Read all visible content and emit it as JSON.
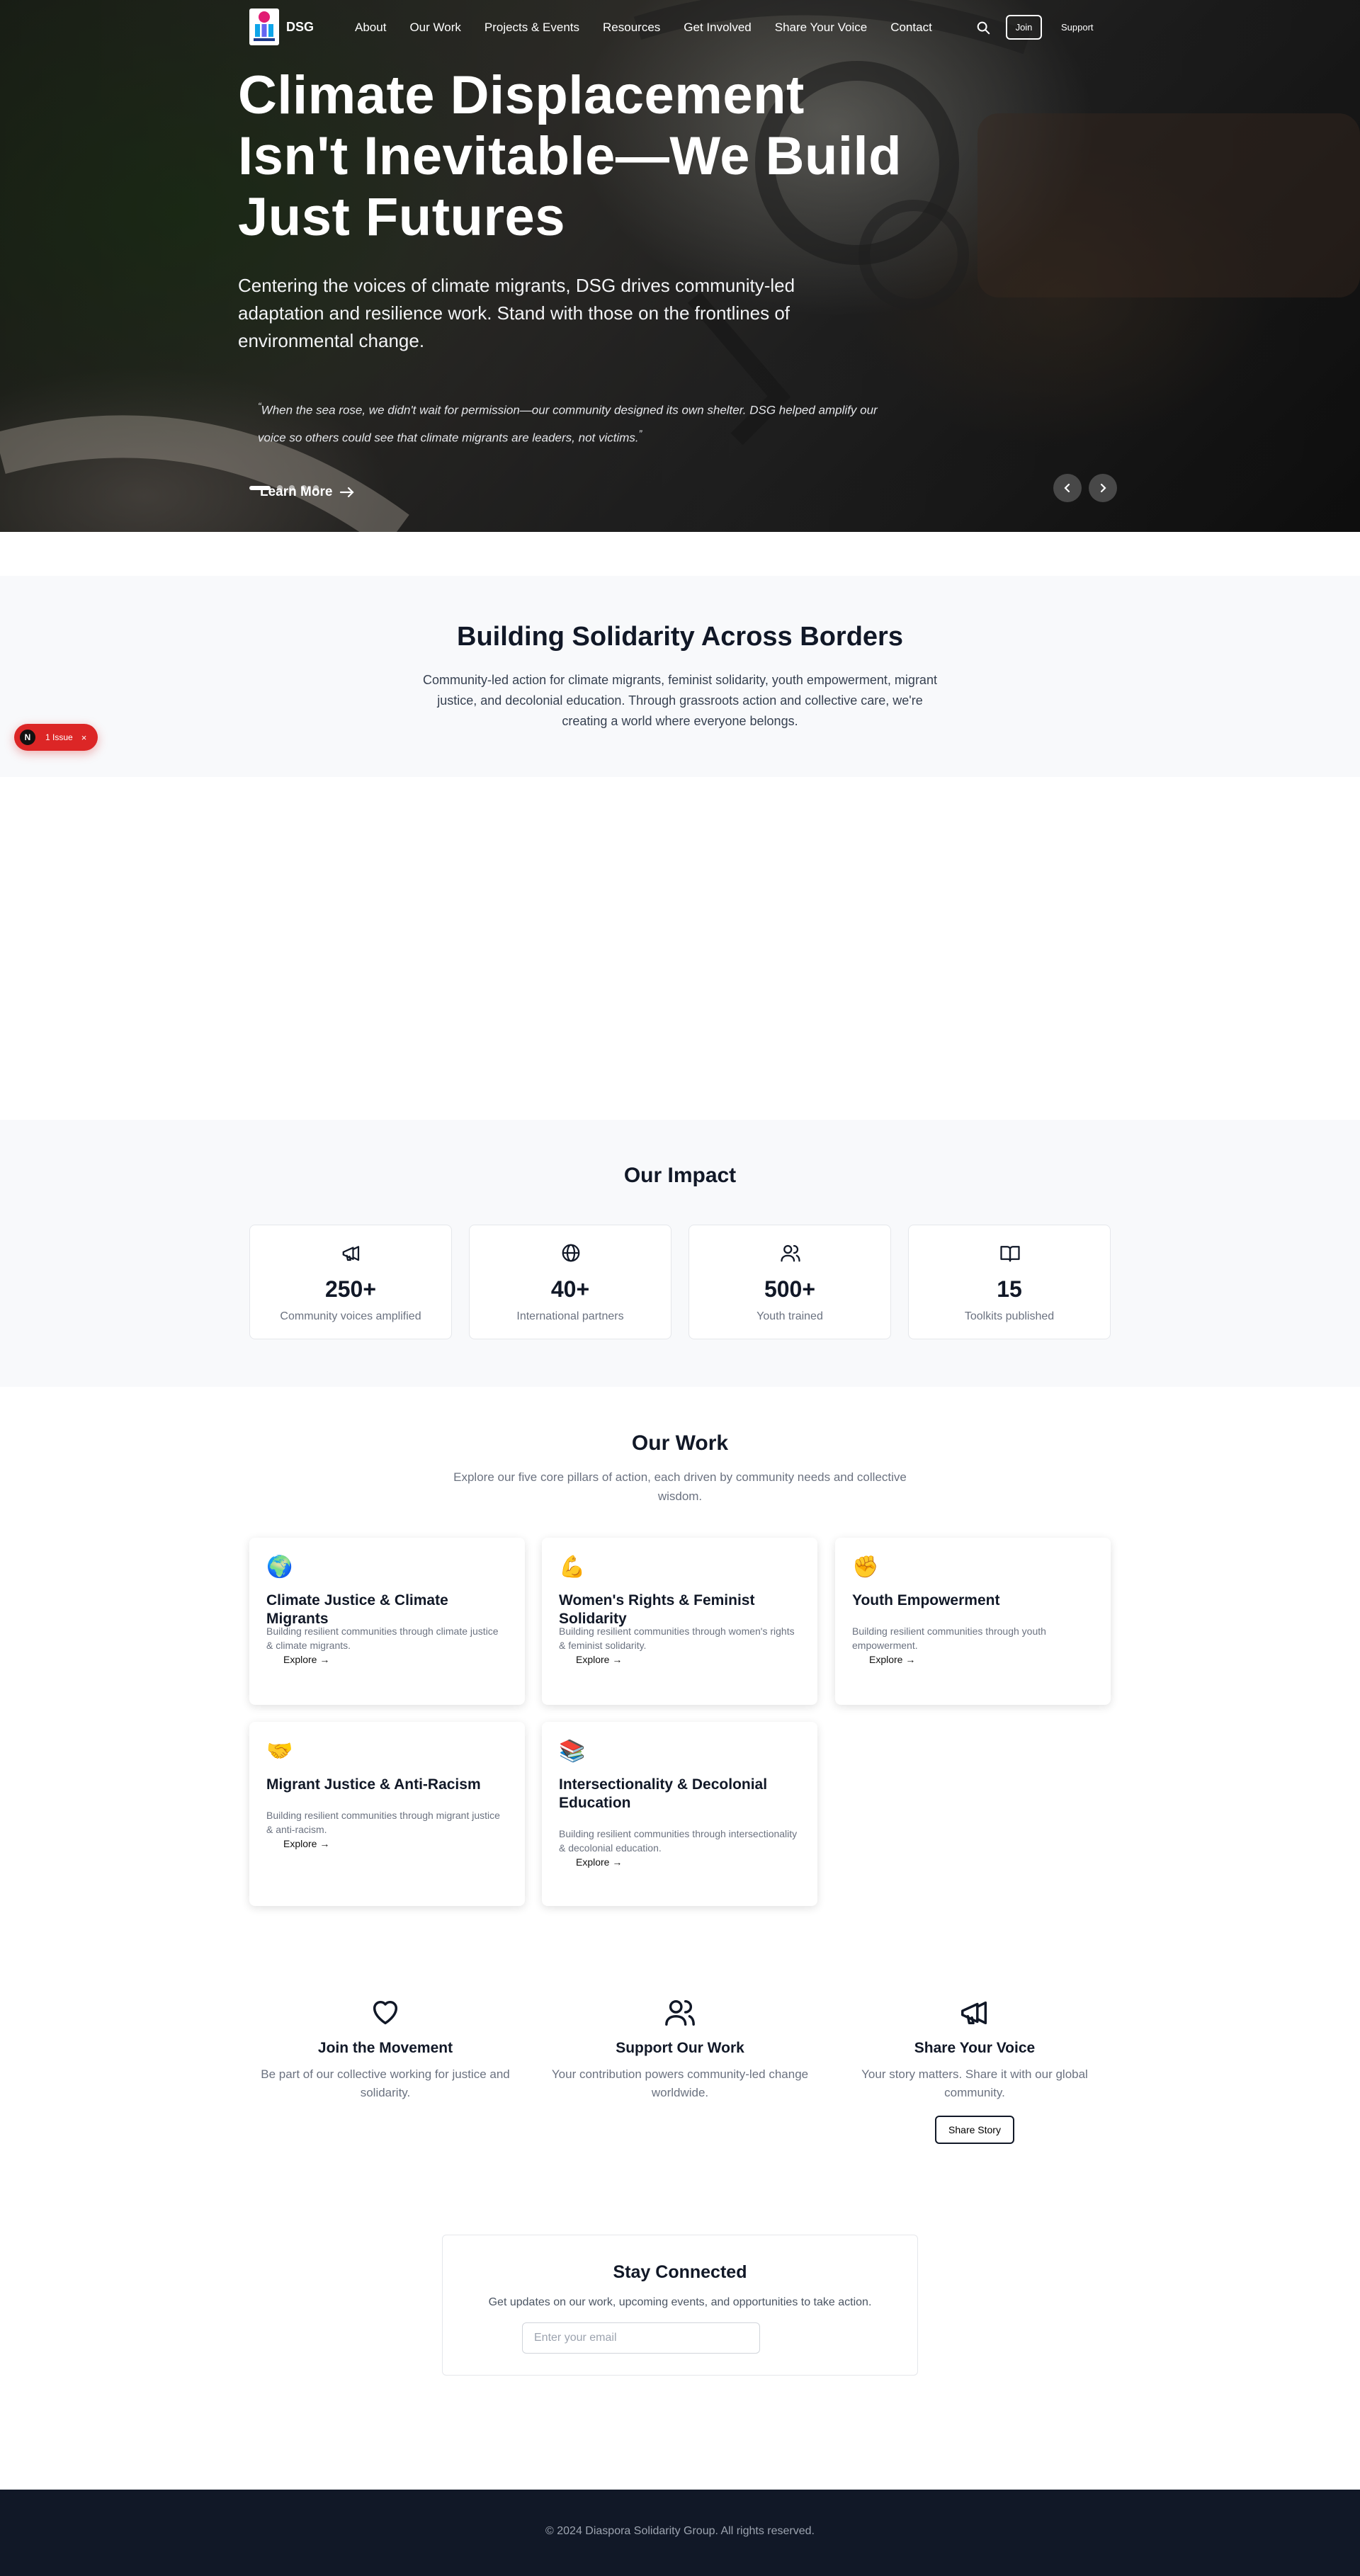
{
  "nav": {
    "brand": "DSG",
    "links": [
      "About",
      "Our Work",
      "Projects & Events",
      "Resources",
      "Get Involved",
      "Share Your Voice",
      "Contact"
    ],
    "join_label": "Join",
    "support_label": "Support"
  },
  "hero": {
    "title": "Climate Displacement Isn't Inevitable—We Build Just Futures",
    "subtitle": "Centering the voices of climate migrants, DSG drives community-led adaptation and resilience work. Stand with those on the frontlines of environmental change.",
    "quote": "When the sea rose, we didn't wait for permission—our community designed its own shelter. DSG helped amplify our voice so others could see that climate migrants are leaders, not victims.",
    "cta_label": "Learn More",
    "slides_total": 5,
    "slide_active": 1
  },
  "solidarity": {
    "title": "Building Solidarity Across Borders",
    "text": "Community-led action for climate migrants, feminist solidarity, youth empowerment, migrant justice, and decolonial education. Through grassroots action and collective care, we're creating a world where everyone belongs."
  },
  "issue_badge": {
    "avatar_letter": "N",
    "label": "1 Issue",
    "close_glyph": "×",
    "color": "#dc2626"
  },
  "impact": {
    "title": "Our Impact",
    "stats": [
      {
        "value": "250+",
        "label": "Community voices amplified",
        "icon": "megaphone-icon"
      },
      {
        "value": "40+",
        "label": "International partners",
        "icon": "globe-icon"
      },
      {
        "value": "500+",
        "label": "Youth trained",
        "icon": "users-icon"
      },
      {
        "value": "15",
        "label": "Toolkits published",
        "icon": "book-open-icon"
      }
    ]
  },
  "work": {
    "title": "Our Work",
    "subtitle": "Explore our five core pillars of action, each driven by community needs and collective wisdom.",
    "link_label": "Explore →",
    "cards": [
      {
        "emoji": "🌍",
        "title": "Climate Justice & Climate Migrants",
        "desc": "Building resilient communities through climate justice & climate migrants."
      },
      {
        "emoji": "💪",
        "title": "Women's Rights & Feminist Solidarity",
        "desc": "Building resilient communities through women's rights & feminist solidarity."
      },
      {
        "emoji": "✊",
        "title": "Youth Empowerment",
        "desc": "Building resilient communities through youth empowerment."
      },
      {
        "emoji": "🤝",
        "title": "Migrant Justice & Anti-Racism",
        "desc": "Building resilient communities through migrant justice & anti-racism."
      },
      {
        "emoji": "📚",
        "title": "Intersectionality & Decolonial Education",
        "desc": "Building resilient communities through intersectionality & decolonial education."
      }
    ]
  },
  "cta": [
    {
      "icon": "heart-icon",
      "title": "Join the Movement",
      "text": "Be part of our collective working for justice and solidarity."
    },
    {
      "icon": "users-icon",
      "title": "Support Our Work",
      "text": "Your contribution powers community-led change worldwide."
    },
    {
      "icon": "megaphone-icon",
      "title": "Share Your Voice",
      "text": "Your story matters. Share it with our global community.",
      "button": "Share Story"
    }
  ],
  "newsletter": {
    "title": "Stay Connected",
    "text": "Get updates on our work, upcoming events, and opportunities to take action.",
    "placeholder": "Enter your email"
  },
  "footer": {
    "text": "© 2024 Diaspora Solidarity Group. All rights reserved."
  },
  "colors": {
    "footer_bg": "#111827",
    "section_bg": "#f8f9fb",
    "issue_red": "#dc2626"
  }
}
